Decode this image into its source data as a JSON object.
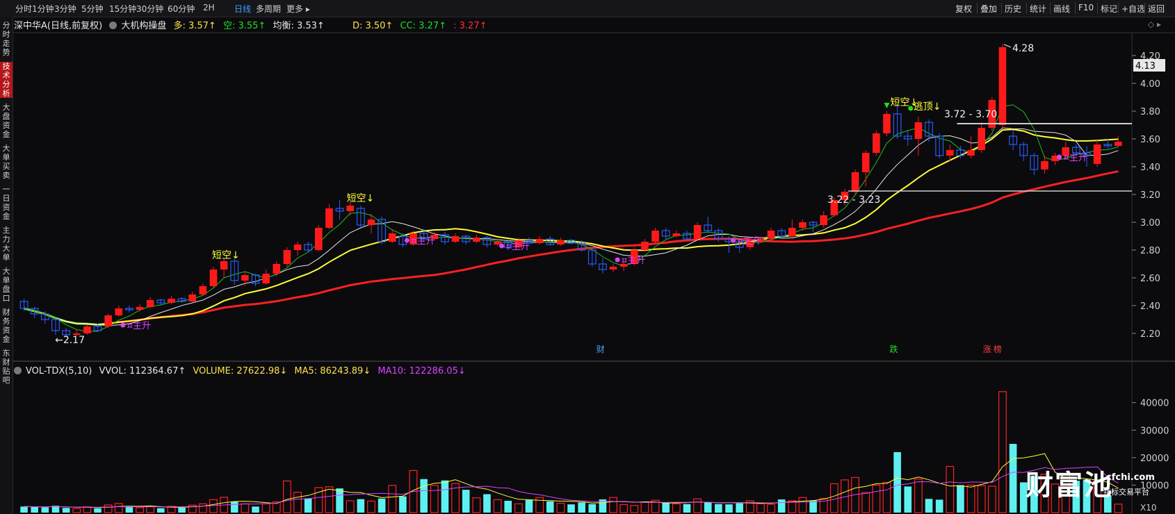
{
  "toolbar": {
    "timeframes": [
      "分时",
      "1分钟",
      "3分钟",
      "5分钟",
      "15分钟",
      "30分钟",
      "60分钟",
      "2H",
      "日线",
      "多周期",
      "更多"
    ],
    "active": "日线",
    "right_buttons": [
      "复权",
      "叠加",
      "历史",
      "统计",
      "画线",
      "F10",
      "标记",
      "+自选",
      "返回"
    ]
  },
  "sidebar": {
    "items": [
      "分时走势",
      "技术分析",
      "大盘资金",
      "大单买卖",
      "一日资金",
      "主力大单",
      "大单盘口",
      "财务资金",
      "东财贴吧"
    ],
    "active": "技术分析"
  },
  "main_header": {
    "stock": "深中华A(日线,前复权)",
    "indicator": "大机构操盘",
    "duo": "多: 3.57↑",
    "kong": "空: 3.55↑",
    "junheng": "均衡: 3.53↑",
    "d": "D: 3.50↑",
    "cc": "CC: 3.27↑",
    "extra": ": 3.27↑"
  },
  "volume_header": {
    "name": "VOL-TDX(5,10)",
    "vvol": "VVOL: 112364.67↑",
    "volume": "VOLUME: 27622.98↓",
    "ma5": "MA5: 86243.89↓",
    "ma10": "MA10: 122286.05↓"
  },
  "colors": {
    "up": "#ff1a1a",
    "down": "#2a5cff",
    "cyan": "#5ef0f0",
    "yellow": "#ffff33",
    "white": "#e8e8e8",
    "green": "#22dd22",
    "magenta": "#e040ff",
    "bg": "#0b0b0e"
  },
  "chart_data": {
    "type": "candlestick",
    "y_axis": {
      "ticks": [
        "4.20",
        "4.00",
        "3.80",
        "3.60",
        "3.40",
        "3.20",
        "3.00",
        "2.80",
        "2.60",
        "2.40",
        "2.20"
      ],
      "current_price": "4.13"
    },
    "vol_axis": {
      "ticks": [
        "40000",
        "30000",
        "20000",
        "10000"
      ],
      "unit": "X10"
    },
    "annotations": {
      "high": "4.28",
      "low": "2.17",
      "resistance": "3.72 - 3.70",
      "support": "3.22 - 3.23",
      "short_signal": "短空↓",
      "top_signal": "逃顶↓",
      "rise_signal": "主升",
      "event_cai": "财",
      "event_die": "跌",
      "event_zhang": "涨",
      "event_bang": "榜"
    },
    "candles": [
      [
        2.43,
        2.38,
        2.45,
        2.36
      ],
      [
        2.38,
        2.34,
        2.39,
        2.31
      ],
      [
        2.34,
        2.3,
        2.36,
        2.27
      ],
      [
        2.3,
        2.22,
        2.31,
        2.19
      ],
      [
        2.22,
        2.19,
        2.24,
        2.17
      ],
      [
        2.19,
        2.2,
        2.23,
        2.18
      ],
      [
        2.2,
        2.25,
        2.26,
        2.19
      ],
      [
        2.25,
        2.22,
        2.27,
        2.21
      ],
      [
        2.25,
        2.33,
        2.34,
        2.24
      ],
      [
        2.33,
        2.38,
        2.4,
        2.32
      ],
      [
        2.38,
        2.37,
        2.4,
        2.35
      ],
      [
        2.37,
        2.39,
        2.41,
        2.36
      ],
      [
        2.39,
        2.44,
        2.46,
        2.38
      ],
      [
        2.44,
        2.42,
        2.45,
        2.4
      ],
      [
        2.42,
        2.45,
        2.47,
        2.41
      ],
      [
        2.45,
        2.43,
        2.46,
        2.42
      ],
      [
        2.43,
        2.48,
        2.5,
        2.42
      ],
      [
        2.48,
        2.54,
        2.56,
        2.47
      ],
      [
        2.54,
        2.66,
        2.68,
        2.53
      ],
      [
        2.66,
        2.72,
        2.74,
        2.6
      ],
      [
        2.72,
        2.58,
        2.74,
        2.55
      ],
      [
        2.58,
        2.62,
        2.64,
        2.54
      ],
      [
        2.62,
        2.56,
        2.63,
        2.54
      ],
      [
        2.56,
        2.63,
        2.66,
        2.55
      ],
      [
        2.63,
        2.7,
        2.72,
        2.61
      ],
      [
        2.7,
        2.8,
        2.82,
        2.68
      ],
      [
        2.8,
        2.84,
        2.86,
        2.76
      ],
      [
        2.84,
        2.8,
        2.86,
        2.78
      ],
      [
        2.8,
        2.96,
        2.98,
        2.79
      ],
      [
        2.96,
        3.1,
        3.13,
        2.95
      ],
      [
        3.1,
        3.08,
        3.16,
        3.02
      ],
      [
        3.08,
        3.12,
        3.15,
        3.05
      ],
      [
        3.1,
        2.98,
        3.12,
        2.96
      ],
      [
        2.98,
        3.02,
        3.06,
        2.92
      ],
      [
        3.02,
        2.86,
        3.04,
        2.84
      ],
      [
        2.86,
        2.92,
        2.95,
        2.85
      ],
      [
        2.9,
        2.84,
        2.92,
        2.82
      ],
      [
        2.84,
        2.92,
        2.94,
        2.83
      ],
      [
        2.92,
        2.88,
        2.95,
        2.86
      ],
      [
        2.88,
        2.91,
        2.93,
        2.87
      ],
      [
        2.91,
        2.86,
        2.93,
        2.84
      ],
      [
        2.86,
        2.9,
        2.92,
        2.85
      ],
      [
        2.9,
        2.86,
        2.91,
        2.84
      ],
      [
        2.86,
        2.89,
        2.91,
        2.85
      ],
      [
        2.89,
        2.84,
        2.9,
        2.82
      ],
      [
        2.84,
        2.86,
        2.88,
        2.83
      ],
      [
        2.86,
        2.82,
        2.88,
        2.8
      ],
      [
        2.82,
        2.87,
        2.89,
        2.81
      ],
      [
        2.87,
        2.85,
        2.89,
        2.84
      ],
      [
        2.85,
        2.88,
        2.9,
        2.84
      ],
      [
        2.88,
        2.84,
        2.9,
        2.83
      ],
      [
        2.84,
        2.87,
        2.89,
        2.83
      ],
      [
        2.87,
        2.85,
        2.88,
        2.84
      ],
      [
        2.85,
        2.8,
        2.87,
        2.79
      ],
      [
        2.8,
        2.7,
        2.82,
        2.68
      ],
      [
        2.7,
        2.66,
        2.74,
        2.63
      ],
      [
        2.66,
        2.68,
        2.7,
        2.64
      ],
      [
        2.68,
        2.7,
        2.72,
        2.65
      ],
      [
        2.7,
        2.8,
        2.82,
        2.69
      ],
      [
        2.8,
        2.86,
        2.88,
        2.79
      ],
      [
        2.86,
        2.94,
        2.96,
        2.85
      ],
      [
        2.94,
        2.9,
        2.96,
        2.88
      ],
      [
        2.9,
        2.92,
        2.94,
        2.89
      ],
      [
        2.92,
        2.88,
        2.94,
        2.87
      ],
      [
        2.88,
        2.98,
        3.0,
        2.87
      ],
      [
        2.98,
        2.94,
        3.04,
        2.92
      ],
      [
        2.94,
        2.88,
        2.96,
        2.86
      ],
      [
        2.88,
        2.86,
        2.9,
        2.78
      ],
      [
        2.86,
        2.82,
        2.88,
        2.78
      ],
      [
        2.82,
        2.86,
        2.88,
        2.8
      ],
      [
        2.86,
        2.88,
        2.9,
        2.85
      ],
      [
        2.88,
        2.94,
        2.96,
        2.87
      ],
      [
        2.94,
        2.9,
        2.96,
        2.88
      ],
      [
        2.9,
        2.96,
        3.02,
        2.89
      ],
      [
        2.96,
        3.0,
        3.02,
        2.94
      ],
      [
        3.0,
        2.98,
        3.01,
        2.93
      ],
      [
        2.98,
        3.05,
        3.08,
        2.96
      ],
      [
        3.05,
        3.16,
        3.18,
        3.04
      ],
      [
        3.16,
        3.22,
        3.24,
        3.12
      ],
      [
        3.22,
        3.36,
        3.38,
        3.2
      ],
      [
        3.36,
        3.5,
        3.52,
        3.26
      ],
      [
        3.5,
        3.64,
        3.66,
        3.48
      ],
      [
        3.64,
        3.78,
        3.8,
        3.62
      ],
      [
        3.78,
        3.62,
        3.84,
        3.6
      ],
      [
        3.62,
        3.6,
        3.66,
        3.55
      ],
      [
        3.6,
        3.72,
        3.76,
        3.48
      ],
      [
        3.72,
        3.62,
        3.74,
        3.58
      ],
      [
        3.62,
        3.48,
        3.64,
        3.46
      ],
      [
        3.48,
        3.52,
        3.56,
        3.44
      ],
      [
        3.52,
        3.48,
        3.55,
        3.46
      ],
      [
        3.48,
        3.52,
        3.62,
        3.46
      ],
      [
        3.52,
        3.68,
        3.72,
        3.5
      ],
      [
        3.68,
        3.88,
        3.9,
        3.66
      ],
      [
        3.7,
        4.26,
        4.28,
        3.68
      ],
      [
        3.62,
        3.56,
        3.66,
        3.52
      ],
      [
        3.56,
        3.48,
        3.58,
        3.44
      ],
      [
        3.48,
        3.38,
        3.5,
        3.34
      ],
      [
        3.38,
        3.44,
        3.48,
        3.35
      ],
      [
        3.44,
        3.48,
        3.5,
        3.41
      ],
      [
        3.48,
        3.54,
        3.58,
        3.46
      ],
      [
        3.54,
        3.5,
        3.56,
        3.47
      ],
      [
        3.5,
        3.48,
        3.55,
        3.4
      ],
      [
        3.42,
        3.56,
        3.6,
        3.4
      ],
      [
        3.56,
        3.55,
        3.6,
        3.53
      ],
      [
        3.55,
        3.58,
        3.62,
        3.54
      ]
    ],
    "volumes": [
      2200,
      2100,
      1900,
      2500,
      1700,
      1500,
      2100,
      1600,
      2800,
      3300,
      2000,
      1800,
      2200,
      1600,
      2300,
      1800,
      2700,
      3200,
      4700,
      5600,
      4000,
      3200,
      2200,
      3200,
      3900,
      11500,
      7400,
      5200,
      9100,
      9400,
      8800,
      4300,
      4900,
      4200,
      5100,
      9900,
      5900,
      15300,
      12200,
      9900,
      11700,
      10600,
      8300,
      5400,
      6700,
      4700,
      4300,
      3200,
      4600,
      5500,
      4100,
      3400,
      3000,
      3700,
      3100,
      4800,
      5500,
      2900,
      2600,
      3800,
      4500,
      3600,
      3200,
      3100,
      5000,
      3700,
      3100,
      3000,
      3400,
      4300,
      3200,
      3000,
      4800,
      4300,
      5500,
      4400,
      5200,
      10500,
      11900,
      12800,
      7300,
      10000,
      11000,
      22000,
      9500,
      12200,
      5000,
      4700,
      16800,
      10000,
      10000,
      9800,
      9600,
      44000,
      25000,
      11000,
      13300,
      14000,
      10400,
      13700,
      11600,
      12000,
      11600,
      6300,
      3100
    ]
  }
}
